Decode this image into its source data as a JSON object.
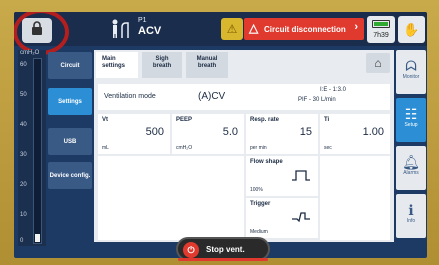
{
  "header": {
    "mode_prefix": "P1",
    "mode": "ACV",
    "alarm_text": "Circuit disconnection",
    "time": "7h39"
  },
  "gauge": {
    "unit": "cmH₂O",
    "ticks": [
      "60",
      "50",
      "40",
      "30",
      "20",
      "10",
      "0"
    ],
    "level_cmH2O": 0
  },
  "nav": {
    "items": [
      {
        "label": "Circuit"
      },
      {
        "label": "Settings"
      },
      {
        "label": "USB"
      },
      {
        "label": "Device config."
      }
    ],
    "active_index": 1
  },
  "tabs": [
    {
      "label": "Main settings"
    },
    {
      "label": "Sigh breath"
    },
    {
      "label": "Manual breath"
    }
  ],
  "settings": {
    "vent_mode_label": "Ventilation mode",
    "vent_mode_value": "(A)CV",
    "ie_text": "I:E - 1:3.0",
    "pif_text": "PIF - 30    L/min",
    "vt": {
      "label": "Vt",
      "value": "500",
      "unit": "mL"
    },
    "peep": {
      "label": "PEEP",
      "value": "5.0",
      "unit": "cmH₂O"
    },
    "resp_rate": {
      "label": "Resp. rate",
      "value": "15",
      "unit": "per min"
    },
    "ti": {
      "label": "Ti",
      "value": "1.00",
      "unit": "sec"
    },
    "flow_shape": {
      "label": "Flow shape",
      "value": "100%"
    },
    "trigger": {
      "label": "Trigger",
      "value": "Medium"
    }
  },
  "right_nav": {
    "items": [
      {
        "label": "Monitor",
        "icon": "lungs-icon"
      },
      {
        "label": "Setup",
        "icon": "setup-icon"
      },
      {
        "label": "Alarms",
        "icon": "bell-icon"
      },
      {
        "label": "Info",
        "icon": "info-icon"
      }
    ],
    "active_index": 1
  },
  "stop_button": {
    "label": "Stop vent."
  },
  "colors": {
    "alarm": "#e03a2f",
    "active": "#2c8fd6",
    "background": "#1c3a63"
  }
}
